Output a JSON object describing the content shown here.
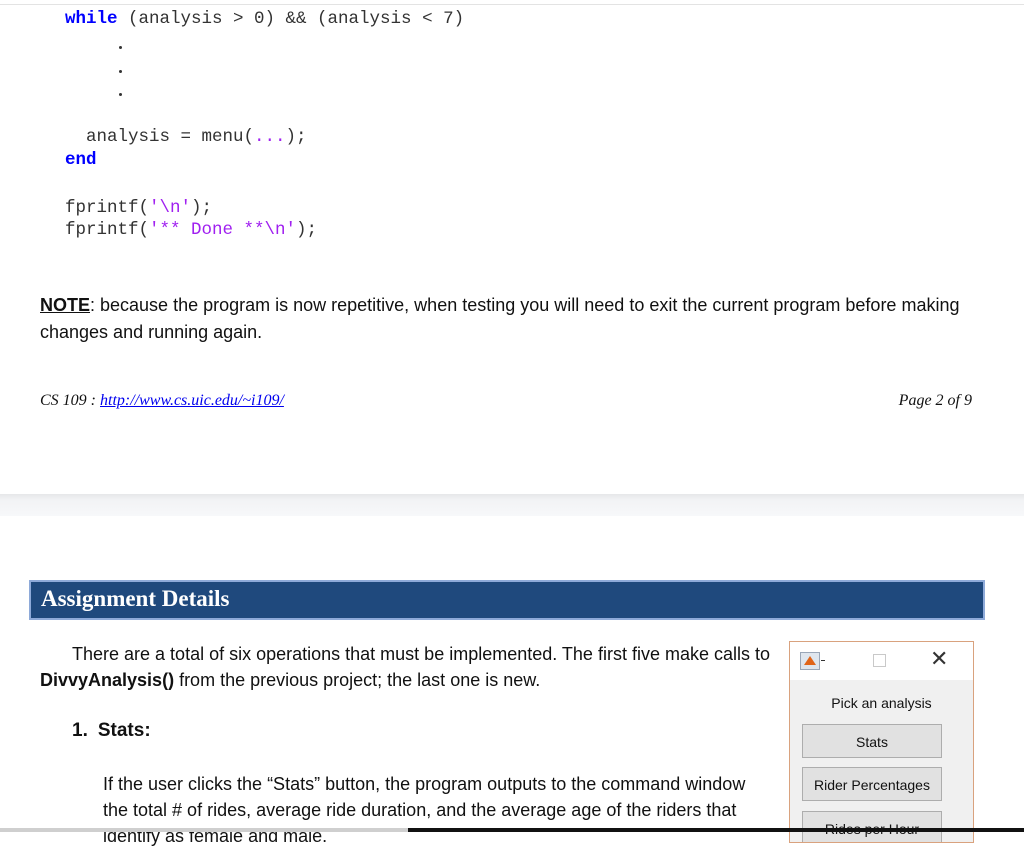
{
  "code": {
    "while_kw": "while",
    "while_cond": " (analysis > 0) && (analysis < 7)",
    "assign_pre": "  analysis = menu(",
    "assign_str": "...",
    "assign_post": ");",
    "end_kw": "end",
    "fprintf1_pre": "fprintf(",
    "fprintf1_str": "'\\n'",
    "fprintf1_post": ");",
    "fprintf2_pre": "fprintf(",
    "fprintf2_str": "'** Done **\\n'",
    "fprintf2_post": ");"
  },
  "note": {
    "label": "NOTE",
    "text": ":  because the program is now repetitive, when testing you will need to exit the current program before making changes and running again."
  },
  "footer": {
    "course": "CS 109 :  ",
    "link": "http://www.cs.uic.edu/~i109/",
    "page": "Page 2 of 9"
  },
  "section": {
    "title": "Assignment Details",
    "intro_pre": "There are a total of six operations that must be implemented.  The first five make calls to ",
    "intro_bold": "DivvyAnalysis()",
    "intro_post": " from the previous project; the last one is new.",
    "item_number": "1.",
    "item_title": "Stats:",
    "item_body": "If the user clicks the “Stats” button, the program outputs to the command window the total # of rides, average ride duration, and the average age of the riders that identify as female and male."
  },
  "dialog": {
    "prompt": "Pick an analysis",
    "buttons": [
      "Stats",
      "Rider Percentages",
      "Rides per Hour"
    ],
    "close_glyph": "✕"
  }
}
